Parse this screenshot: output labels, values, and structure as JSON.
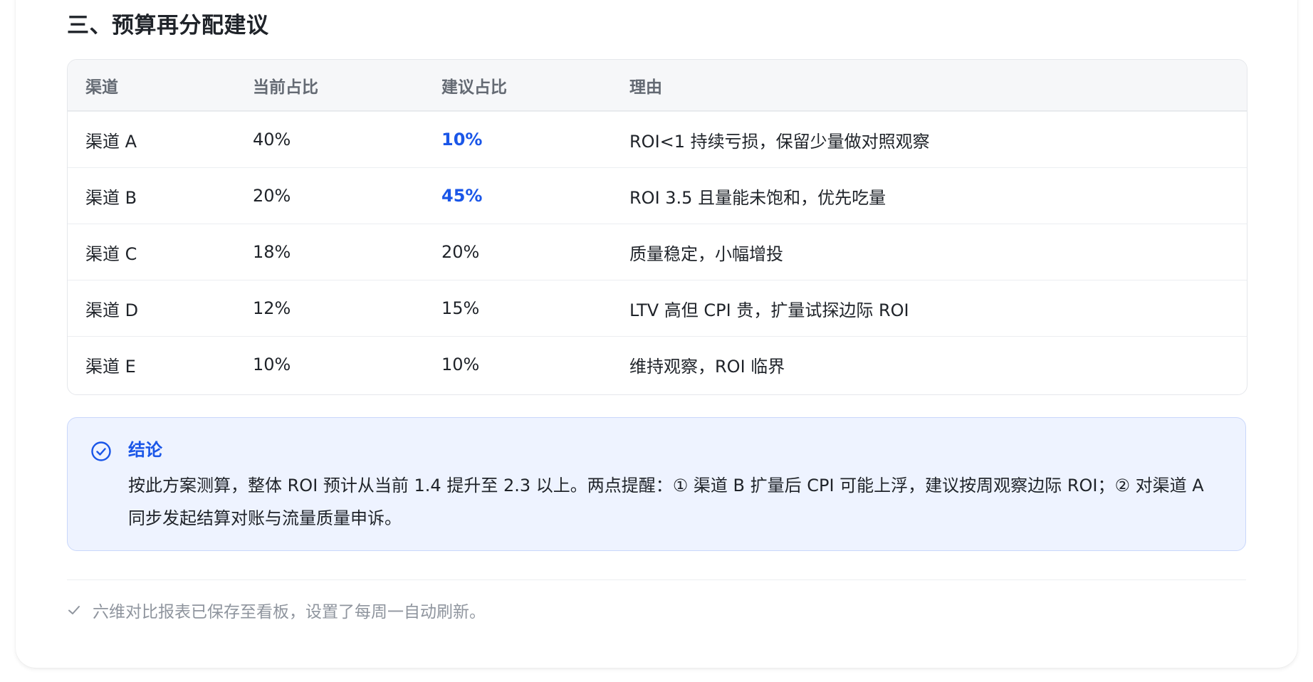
{
  "section": {
    "title": "三、预算再分配建议"
  },
  "table": {
    "headers": [
      "渠道",
      "当前占比",
      "建议占比",
      "理由"
    ],
    "rows": [
      {
        "channel": "渠道 A",
        "current": "40%",
        "suggested": "10%",
        "reason": "ROI<1 持续亏损，保留少量做对照观察",
        "highlight": true
      },
      {
        "channel": "渠道 B",
        "current": "20%",
        "suggested": "45%",
        "reason": "ROI 3.5 且量能未饱和，优先吃量",
        "highlight": true
      },
      {
        "channel": "渠道 C",
        "current": "18%",
        "suggested": "20%",
        "reason": "质量稳定，小幅增投",
        "highlight": false
      },
      {
        "channel": "渠道 D",
        "current": "12%",
        "suggested": "15%",
        "reason": "LTV 高但 CPI 贵，扩量试探边际 ROI",
        "highlight": false
      },
      {
        "channel": "渠道 E",
        "current": "10%",
        "suggested": "10%",
        "reason": "维持观察，ROI 临界",
        "highlight": false
      }
    ]
  },
  "conclusion": {
    "icon": "check-circle-icon",
    "title": "结论",
    "body": "按此方案测算，整体 ROI 预计从当前 1.4 提升至 2.3 以上。两点提醒：① 渠道 B 扩量后 CPI 可能上浮，建议按周观察边际 ROI；② 对渠道 A 同步发起结算对账与流量质量申诉。"
  },
  "footer": {
    "icon": "check-icon",
    "note": "六维对比报表已保存至看板，设置了每周一自动刷新。"
  },
  "colors": {
    "accent": "#1a56e8",
    "conclusion_bg": "#eef3ff",
    "muted_text": "#8f959e"
  }
}
